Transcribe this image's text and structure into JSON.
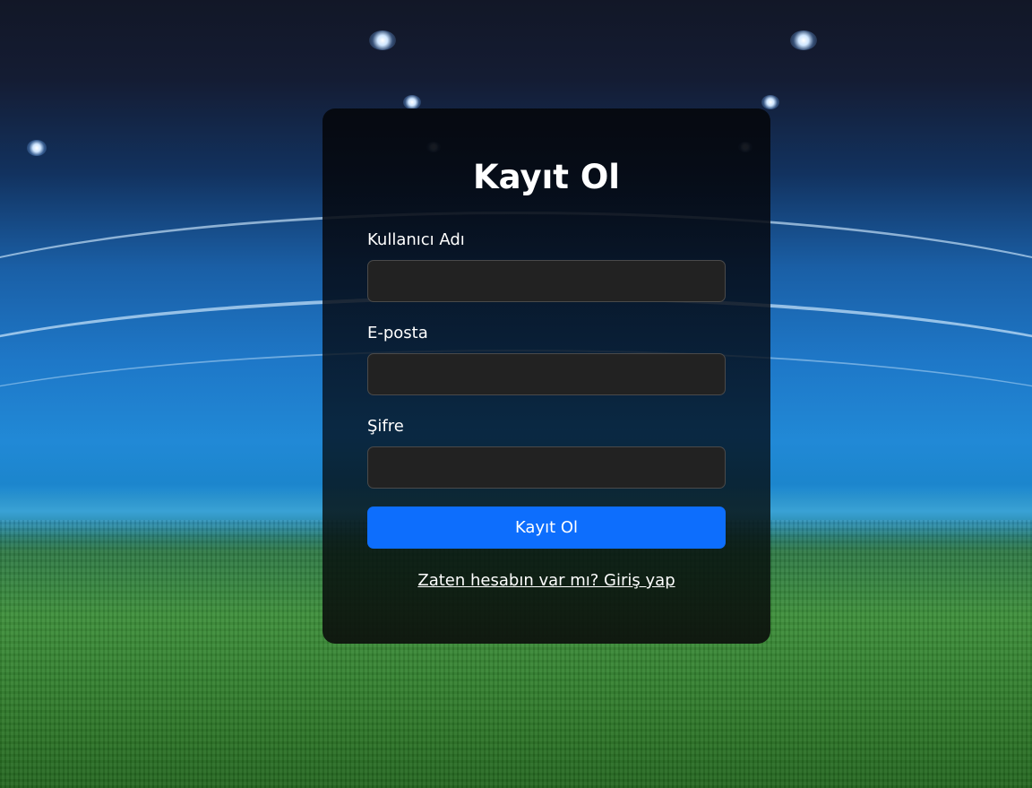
{
  "register_form": {
    "title": "Kayıt Ol",
    "fields": [
      {
        "label": "Kullanıcı Adı",
        "value": "",
        "placeholder": ""
      },
      {
        "label": "E-posta",
        "value": "",
        "placeholder": ""
      },
      {
        "label": "Şifre",
        "value": "",
        "placeholder": ""
      }
    ],
    "submit_label": "Kayıt Ol",
    "login_link": "Zaten hesabın var mı? Giriş yap"
  },
  "colors": {
    "primary_button": "#0d6efd",
    "input_background": "#222222",
    "card_background": "#05080e"
  },
  "icons": {
    "background": "stadium-background-image"
  }
}
